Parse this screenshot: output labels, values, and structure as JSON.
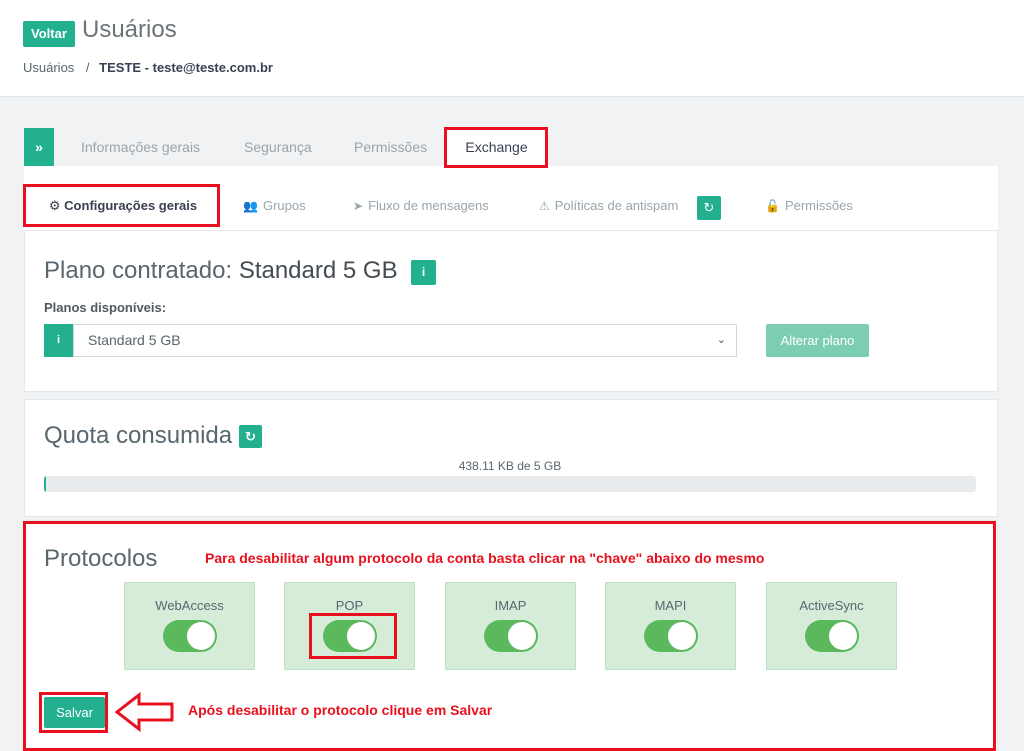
{
  "header": {
    "back_label": "Voltar",
    "title": "Usuários",
    "breadcrumb": {
      "root": "Usuários",
      "separator": "/",
      "current": "TESTE - teste@teste.com.br"
    }
  },
  "tabs": {
    "toggle_icon": "double-chevron-right-icon",
    "items": [
      "Informações gerais",
      "Segurança",
      "Permissões"
    ],
    "active": "Exchange"
  },
  "subtabs": {
    "active": "Configurações gerais",
    "items": [
      "Grupos",
      "Fluxo de mensagens",
      "Políticas de antispam",
      "Permissões"
    ]
  },
  "plano": {
    "heading_prefix": "Plano contratado:",
    "heading_value": "Standard 5 GB",
    "info_icon": "i",
    "select_label": "Planos disponíveis:",
    "select_value": "Standard 5 GB",
    "change_button": "Alterar plano"
  },
  "quota": {
    "heading": "Quota consumida",
    "usage_text": "438.11 KB de 5 GB",
    "fill_fraction": 0.002
  },
  "protocolos": {
    "heading": "Protocolos",
    "note": "Para desabilitar algum protocolo da conta basta clicar na \"chave\" abaixo do mesmo",
    "items": [
      {
        "name": "WebAccess",
        "enabled": true
      },
      {
        "name": "POP",
        "enabled": true
      },
      {
        "name": "IMAP",
        "enabled": true
      },
      {
        "name": "MAPI",
        "enabled": true
      },
      {
        "name": "ActiveSync",
        "enabled": true
      }
    ],
    "save_button": "Salvar",
    "save_note": "Após desabilitar o protocolo clique em Salvar"
  },
  "colors": {
    "accent": "#23b08f",
    "toggle_on": "#5bb85d",
    "protocol_bg": "#d5edd8",
    "highlight": "#e8101e"
  }
}
